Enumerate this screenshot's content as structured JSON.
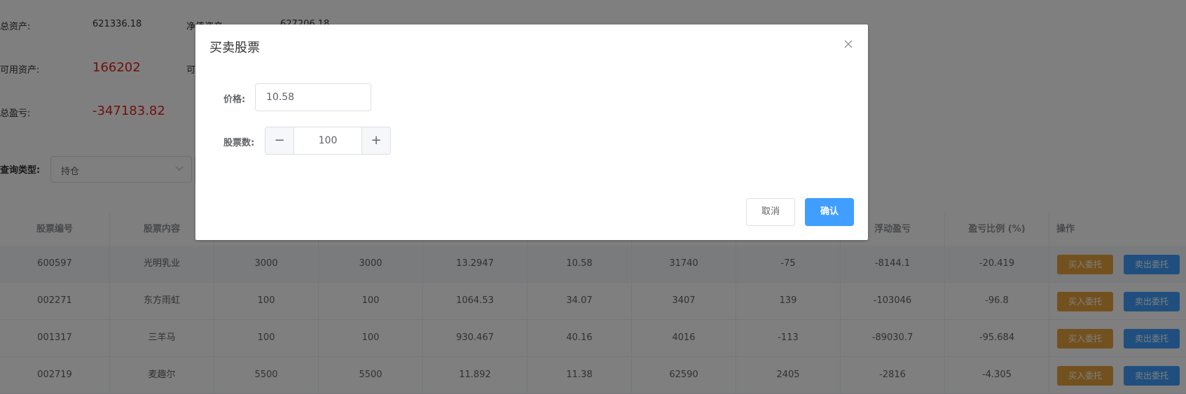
{
  "summary": {
    "total_assets_label": "总资产:",
    "total_assets_value": "621336.18",
    "net_assets_label": "净值资产:",
    "net_assets_value": "627206.18",
    "available_label": "可用资产:",
    "available_value": "166202",
    "available2_label": "可",
    "total_pnl_label": "总盈亏:",
    "total_pnl_value": "-347183.82"
  },
  "query": {
    "label": "查询类型:",
    "selected": "持仓"
  },
  "table": {
    "headers": [
      "股票编号",
      "股票内容",
      "",
      "",
      "",
      "",
      "",
      "",
      "浮动盈亏",
      "盈亏比例 (%)",
      "操作"
    ],
    "buy_label": "买入委托",
    "sell_label": "卖出委托",
    "rows": [
      [
        "600597",
        "光明乳业",
        "3000",
        "3000",
        "13.2947",
        "10.58",
        "31740",
        "-75",
        "-8144.1",
        "-20.419"
      ],
      [
        "002271",
        "东方雨虹",
        "100",
        "100",
        "1064.53",
        "34.07",
        "3407",
        "139",
        "-103046",
        "-96.8"
      ],
      [
        "001317",
        "三羊马",
        "100",
        "100",
        "930.467",
        "40.16",
        "4016",
        "-113",
        "-89030.7",
        "-95.684"
      ],
      [
        "002719",
        "麦趣尔",
        "5500",
        "5500",
        "11.892",
        "11.38",
        "62590",
        "2405",
        "-2816",
        "-4.305"
      ]
    ]
  },
  "dialog": {
    "title": "买卖股票",
    "price_label": "价格:",
    "price_value": "10.58",
    "quantity_label": "股票数:",
    "quantity_value": "100",
    "minus_symbol": "−",
    "plus_symbol": "+",
    "cancel_label": "取消",
    "confirm_label": "确认"
  },
  "colors": {
    "primary": "#409eff",
    "warning": "#e6a23c",
    "danger_text": "#e2231a"
  }
}
